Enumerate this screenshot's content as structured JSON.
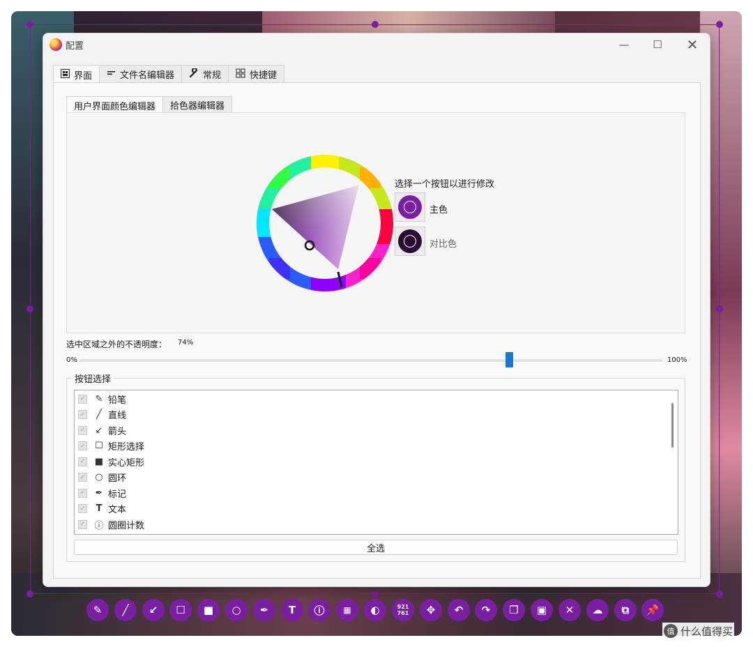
{
  "window": {
    "title": "配置",
    "minimize_icon": "—",
    "maximize_icon": "☐",
    "close_icon": "✕"
  },
  "tabs_main": [
    {
      "label": "界面",
      "icon": "interface-icon"
    },
    {
      "label": "文件名编辑器",
      "icon": "filename-editor-icon"
    },
    {
      "label": "常规",
      "icon": "wrench-icon"
    },
    {
      "label": "快捷键",
      "icon": "shortcut-grid-icon"
    }
  ],
  "tabs_sub": [
    {
      "label": "用户界面颜色编辑器"
    },
    {
      "label": "拾色器编辑器"
    }
  ],
  "color_editor": {
    "caption": "选择一个按钮以进行修改",
    "main_color_label": "主色",
    "contrast_color_label": "对比色",
    "main_color": "#7b1fa2",
    "contrast_color": "#2a0b36"
  },
  "opacity": {
    "label": "选中区域之外的不透明度：",
    "value_text": "74%",
    "value": 74,
    "min_label": "0%",
    "max_label": "100%"
  },
  "button_selection": {
    "title": "按钮选择",
    "items": [
      {
        "label": "铅笔",
        "icon": "pencil-icon",
        "checked": true
      },
      {
        "label": "直线",
        "icon": "line-icon",
        "checked": true
      },
      {
        "label": "箭头",
        "icon": "arrow-icon",
        "checked": true
      },
      {
        "label": "矩形选择",
        "icon": "rectangle-outline-icon",
        "checked": true
      },
      {
        "label": "实心矩形",
        "icon": "rectangle-filled-icon",
        "checked": true
      },
      {
        "label": "圆环",
        "icon": "circle-outline-icon",
        "checked": true
      },
      {
        "label": "标记",
        "icon": "marker-icon",
        "checked": true
      },
      {
        "label": "文本",
        "icon": "text-icon",
        "checked": true
      },
      {
        "label": "圆圈计数",
        "icon": "circle-count-icon",
        "checked": true
      }
    ],
    "select_all_label": "全选"
  },
  "toolbar": {
    "accent": "#7b1fa2",
    "counter_text_top": "921",
    "counter_text_bottom": "761",
    "buttons": [
      "pencil",
      "line",
      "arrow",
      "rectangle",
      "filled-rectangle",
      "circle",
      "marker",
      "text",
      "circle-count",
      "pixelate",
      "invert",
      "size-indicator",
      "move",
      "undo",
      "redo",
      "copy",
      "save",
      "exit",
      "upload",
      "app-launcher",
      "pin"
    ]
  },
  "watermark": {
    "text": "什么值得买",
    "icon_text": "值"
  }
}
